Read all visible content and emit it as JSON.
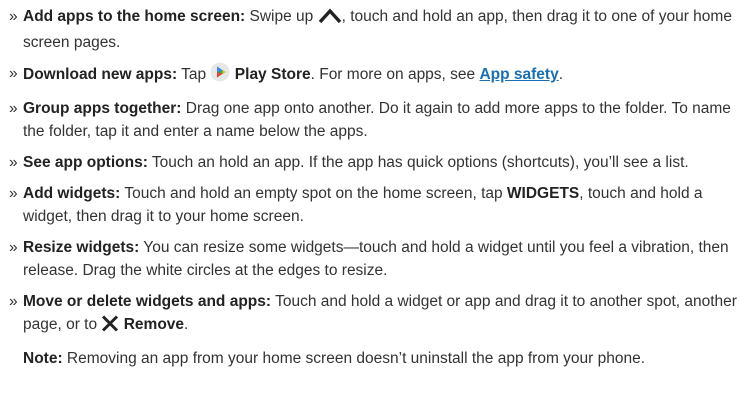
{
  "bullets": [
    {
      "heading": "Add apps to the home screen:",
      "t1": " Swipe up ",
      "t2": ", touch and hold an app, then drag it to one of your home screen pages."
    },
    {
      "heading": "Download new apps:",
      "t1": " Tap ",
      "bold1": "Play Store",
      "t2": ". For more on apps, see ",
      "link": "App safety",
      "t3": "."
    },
    {
      "heading": "Group apps together:",
      "t1": " Drag one app onto another. Do it again to add more apps to the folder. To name the folder, tap it and enter a name below the apps."
    },
    {
      "heading": "See app options:",
      "t1": " Touch an hold an app. If the app has quick options (shortcuts), you’ll see a list."
    },
    {
      "heading": "Add widgets:",
      "t1": " Touch and hold an empty spot on the home screen, tap ",
      "bold1": "WIDGETS",
      "t2": ", touch and hold a widget, then drag it to your home screen."
    },
    {
      "heading": "Resize widgets:",
      "t1": " You can resize some widgets—touch and hold a widget until you feel a vibration, then release. Drag the white circles at the edges to resize."
    },
    {
      "heading": "Move or delete widgets and apps:",
      "t1": " Touch and hold a widget or app and drag it to another spot, another page, or to ",
      "bold1": "Remove",
      "t2": "."
    }
  ],
  "bullet_marker": "»",
  "note": {
    "label": "Note:",
    "text": " Removing an app from your home screen doesn’t uninstall the app from your phone."
  },
  "icons": {
    "swipe_up": "chevron-up-icon",
    "play_store": "play-store-icon",
    "remove": "close-x-icon"
  },
  "colors": {
    "text": "#333333",
    "link": "#1a6fb0",
    "play_store_circle": "#e8e8e8"
  }
}
